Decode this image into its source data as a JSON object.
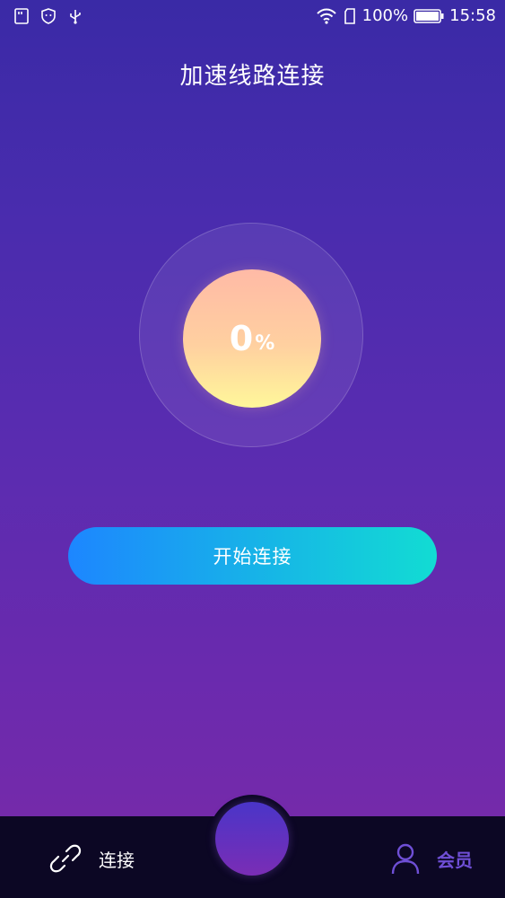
{
  "status_bar": {
    "left_icons": [
      "sim-card-icon",
      "shield-icon",
      "usb-icon"
    ],
    "wifi_icon": "wifi-icon",
    "sim_icon": "sim-slot-icon",
    "battery_percent": "100%",
    "battery_icon": "battery-full-icon",
    "time": "15:58"
  },
  "header": {
    "title": "加速线路连接"
  },
  "progress": {
    "value": "0",
    "unit": "%"
  },
  "main": {
    "connect_label": "开始连接"
  },
  "bottom_nav": {
    "items": [
      {
        "label": "连接",
        "icon": "link-icon",
        "active": true
      },
      {
        "label": "会员",
        "icon": "user-icon",
        "active": false
      }
    ]
  },
  "colors": {
    "background_top": "#3a2aa6",
    "background_bottom": "#7a2aa8",
    "button_start": "#1d86ff",
    "button_end": "#12dcd3",
    "nav_bar": "#0c0724",
    "inactive_nav": "#6f4fd6"
  }
}
